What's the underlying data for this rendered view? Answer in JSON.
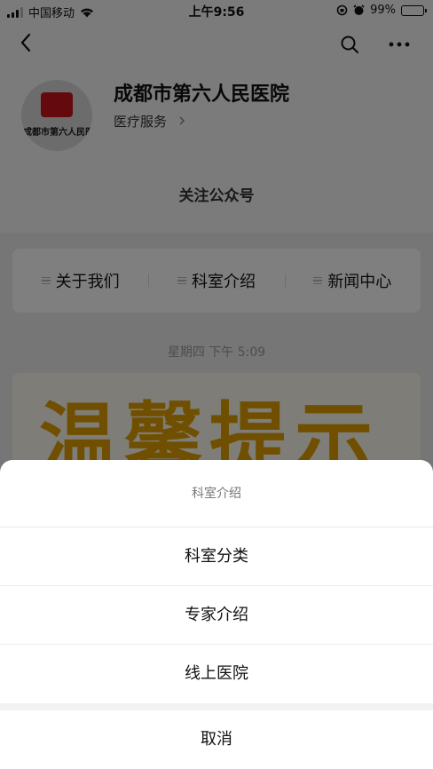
{
  "status_bar": {
    "carrier": "中国移动",
    "time": "上午9:56",
    "battery": "99%",
    "battery_level": 0.99
  },
  "account": {
    "name": "成都市第六人民医院",
    "category": "医疗服务",
    "logo_text": "成都市第六人民医院",
    "follow_label": "关注公众号"
  },
  "menu": {
    "items": [
      {
        "label": "关于我们"
      },
      {
        "label": "科室介绍"
      },
      {
        "label": "新闻中心"
      }
    ]
  },
  "message": {
    "time": "星期四 下午 5:09",
    "banner_text": "温馨提示"
  },
  "action_sheet": {
    "title": "科室介绍",
    "options": [
      {
        "label": "科室分类"
      },
      {
        "label": "专家介绍"
      },
      {
        "label": "线上医院"
      }
    ],
    "cancel_label": "取消"
  },
  "colors": {
    "logo_red": "#c8141e",
    "banner_gold": "#e0a000"
  }
}
